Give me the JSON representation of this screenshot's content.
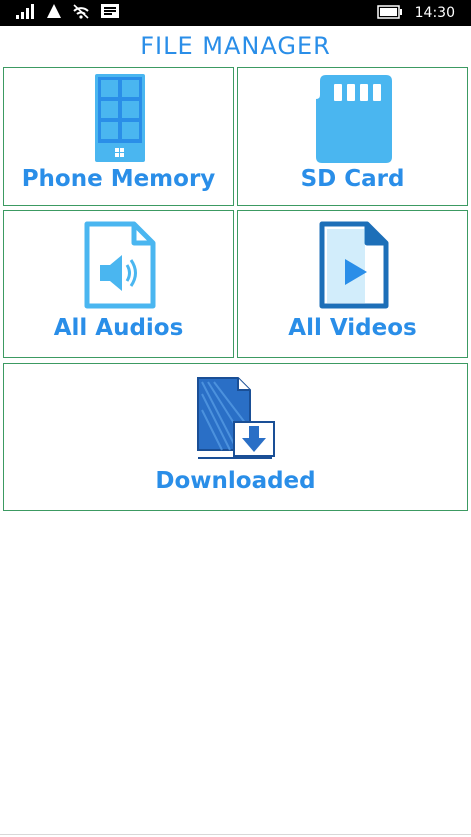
{
  "status_bar": {
    "time": "14:30",
    "icons": [
      "signal-icon",
      "airplane-icon",
      "wifi-icon",
      "message-icon",
      "battery-icon"
    ]
  },
  "app": {
    "title": "FILE MANAGER"
  },
  "tiles": [
    {
      "label": "Phone Memory",
      "icon": "phone-memory-icon"
    },
    {
      "label": "SD Card",
      "icon": "sd-card-icon"
    },
    {
      "label": "All Audios",
      "icon": "audio-file-icon"
    },
    {
      "label": "All Videos",
      "icon": "video-file-icon"
    },
    {
      "label": "Downloaded",
      "icon": "download-icon"
    }
  ],
  "colors": {
    "accent": "#2a8ee8",
    "icon_blue": "#4ab6f0",
    "tile_border": "#3c9a62",
    "status_bar": "#000000"
  }
}
